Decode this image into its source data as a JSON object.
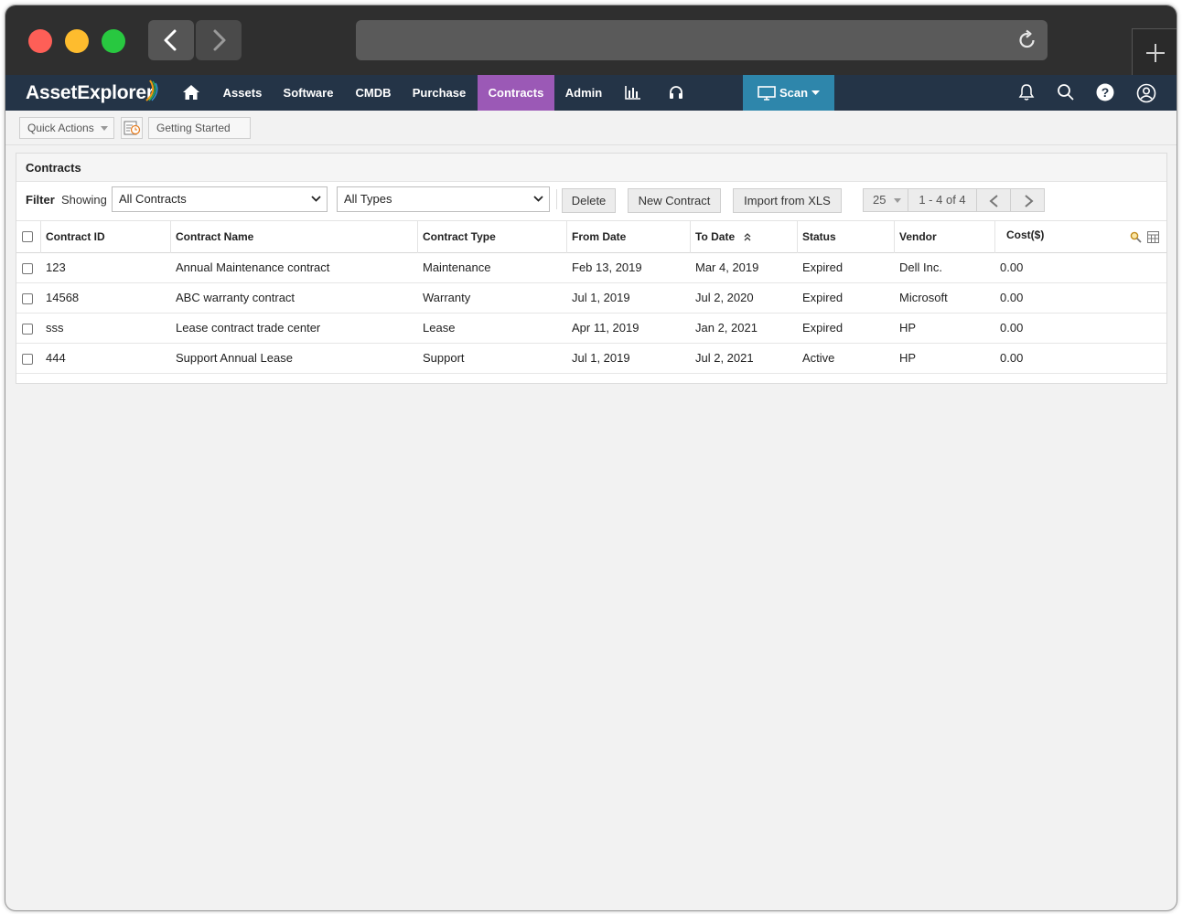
{
  "app": {
    "logo": "AssetExplorer",
    "nav": [
      "Assets",
      "Software",
      "CMDB",
      "Purchase",
      "Contracts",
      "Admin"
    ],
    "active_nav": "Contracts",
    "scan_label": "Scan",
    "accent_color": "#9b59b6",
    "header_color": "#243447"
  },
  "toolbar": {
    "quick_actions": "Quick Actions",
    "getting_started": "Getting Started"
  },
  "panel": {
    "title": "Contracts",
    "filter_label": "Filter",
    "showing_label": "Showing",
    "contracts_filter": "All Contracts",
    "types_filter": "All Types",
    "delete_label": "Delete",
    "new_contract_label": "New Contract",
    "import_label": "Import from XLS",
    "page_size": "25",
    "page_range": "1 - 4 of 4"
  },
  "table": {
    "columns": [
      "Contract ID",
      "Contract Name",
      "Contract Type",
      "From Date",
      "To Date",
      "Status",
      "Vendor",
      "Cost($)"
    ],
    "sorted_column": "To Date",
    "rows": [
      {
        "id": "123",
        "name": "Annual Maintenance contract",
        "type": "Maintenance",
        "from": "Feb 13, 2019",
        "to": "Mar 4, 2019",
        "status": "Expired",
        "vendor": "Dell Inc.",
        "cost": "0.00"
      },
      {
        "id": "14568",
        "name": "ABC warranty contract",
        "type": "Warranty",
        "from": "Jul 1, 2019",
        "to": "Jul 2, 2020",
        "status": "Expired",
        "vendor": "Microsoft",
        "cost": "0.00"
      },
      {
        "id": "sss",
        "name": "Lease contract trade center",
        "type": "Lease",
        "from": "Apr 11, 2019",
        "to": "Jan 2, 2021",
        "status": "Expired",
        "vendor": "HP",
        "cost": "0.00"
      },
      {
        "id": "444",
        "name": "Support Annual Lease",
        "type": "Support",
        "from": "Jul 1, 2019",
        "to": "Jul 2, 2021",
        "status": "Active",
        "vendor": "HP",
        "cost": "0.00"
      }
    ]
  }
}
